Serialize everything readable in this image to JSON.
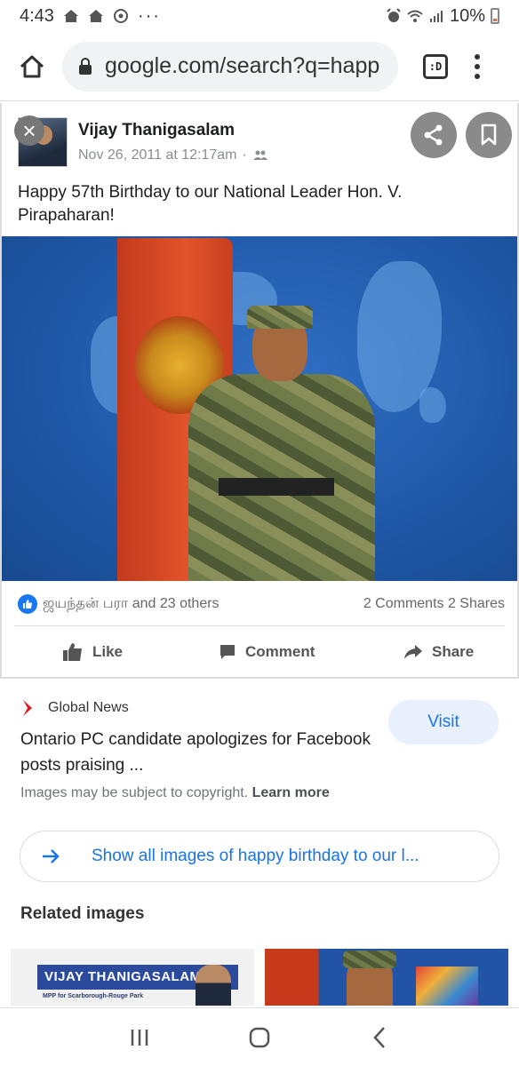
{
  "status_bar": {
    "time": "4:43",
    "battery": "10%"
  },
  "browser": {
    "url": "google.com/search?q=happ",
    "tab_label": ":D"
  },
  "post": {
    "author": "Vijay Thanigasalam",
    "date": "Nov 26, 2011 at 12:17am",
    "date_separator": "·",
    "text": "Happy 57th Birthday to our National Leader Hon. V. Pirapaharan!",
    "reactions_text": "ஜயந்தன் பரா and 23 others",
    "counts_text": "2 Comments 2 Shares",
    "actions": {
      "like": "Like",
      "comment": "Comment",
      "share": "Share"
    }
  },
  "source": {
    "name": "Global News",
    "visit_label": "Visit",
    "headline": "Ontario PC candidate apologizes for Facebook posts praising ...",
    "copyright_text": "Images may be subject to copyright.",
    "learn_more": "Learn more"
  },
  "show_all_label": "Show all images of happy birthday to our l...",
  "related": {
    "title": "Related images",
    "thumb1_banner": "VIJAY THANIGASALAM",
    "thumb1_sub": "MPP for Scarborough-Rouge Park"
  },
  "colors": {
    "accent": "#1a73e8",
    "facebook_blue": "#1877f2",
    "visit_bg": "#e8f0fe"
  },
  "icons": [
    "home-icon",
    "lock-icon",
    "tab-switcher-icon",
    "menu-icon",
    "close-icon",
    "share-icon",
    "bookmark-icon",
    "like-icon",
    "comment-icon",
    "share-arrow-icon",
    "global-news-logo",
    "arrow-right-icon",
    "recents-icon",
    "home-nav-icon",
    "back-icon"
  ]
}
